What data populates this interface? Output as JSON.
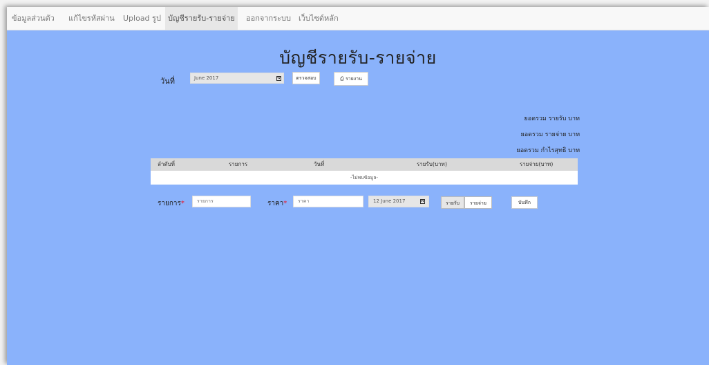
{
  "nav": {
    "items": [
      {
        "label": "ข้อมูลส่วนตัว"
      },
      {
        "label": "แก้ไขรหัสผ่าน"
      },
      {
        "label": "Upload รูป"
      },
      {
        "label": "บัญชีรายรับ-รายจ่าย",
        "active": true
      },
      {
        "label": "ออกจากระบบ"
      },
      {
        "label": "เว็บไซต์หลัก"
      }
    ]
  },
  "page": {
    "title": "บัญชีรายรับ-รายจ่าย"
  },
  "filter": {
    "date_label": "วันที่",
    "month_value": "June 2017",
    "check_label": "ตรวจสอบ",
    "report_label": "รายงาน"
  },
  "summary": {
    "income": "ยอดรวม รายรับ บาท",
    "expense": "ยอดรวม รายจ่าย บาท",
    "profit": "ยอดรวม กำไรสุทธิ บาท"
  },
  "table": {
    "columns": [
      "ลำดับที่",
      "รายการ",
      "วันที่",
      "รายรับ(บาท)",
      "รายจ่าย(บาท)"
    ],
    "empty_text": "-ไม่พบข้อมูล-"
  },
  "form": {
    "item_label": "รายการ",
    "item_placeholder": "รายการ",
    "price_label": "ราคา",
    "price_placeholder": "ราคา",
    "date_value": "12 June 2017",
    "income_toggle": "รายรับ",
    "expense_toggle": "รายจ่าย",
    "save_label": "บันทึก"
  },
  "colors": {
    "background": "#8ab2fb",
    "navbar": "#f8f8f8",
    "required": "#e11122"
  }
}
